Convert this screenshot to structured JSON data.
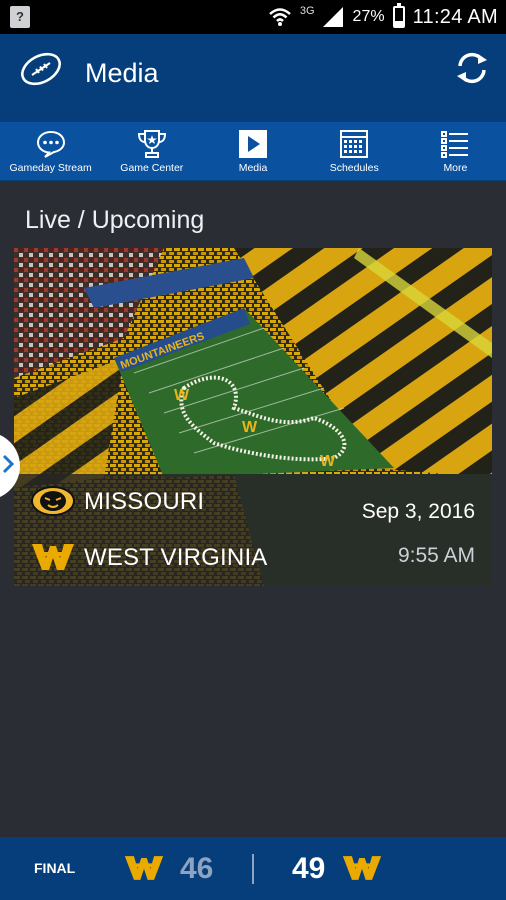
{
  "status_bar": {
    "network": "3G",
    "battery": "27%",
    "time": "11:24 AM"
  },
  "app_bar": {
    "title": "Media"
  },
  "tabs": [
    {
      "label": "Gameday Stream",
      "icon": "chat-bubble-icon"
    },
    {
      "label": "Game Center",
      "icon": "trophy-icon"
    },
    {
      "label": "Media",
      "icon": "play-icon"
    },
    {
      "label": "Schedules",
      "icon": "calendar-icon"
    },
    {
      "label": "More",
      "icon": "list-icon"
    }
  ],
  "section": {
    "title": "Live / Upcoming"
  },
  "game_card": {
    "field_text": "MOUNTAINEERS",
    "away_team": {
      "name": "MISSOURI",
      "logo": "missouri-tiger-logo",
      "meta": "Sep 3, 2016"
    },
    "home_team": {
      "name": "WEST VIRGINIA",
      "logo": "wv-flying-logo",
      "meta": "9:55 AM"
    }
  },
  "score_bar": {
    "status": "FINAL",
    "score_left": "46",
    "score_right": "49"
  },
  "colors": {
    "primary": "#063e7b",
    "tab_bar": "#0a52a0",
    "background": "#2b2d34",
    "wv_gold": "#eaaa00"
  }
}
